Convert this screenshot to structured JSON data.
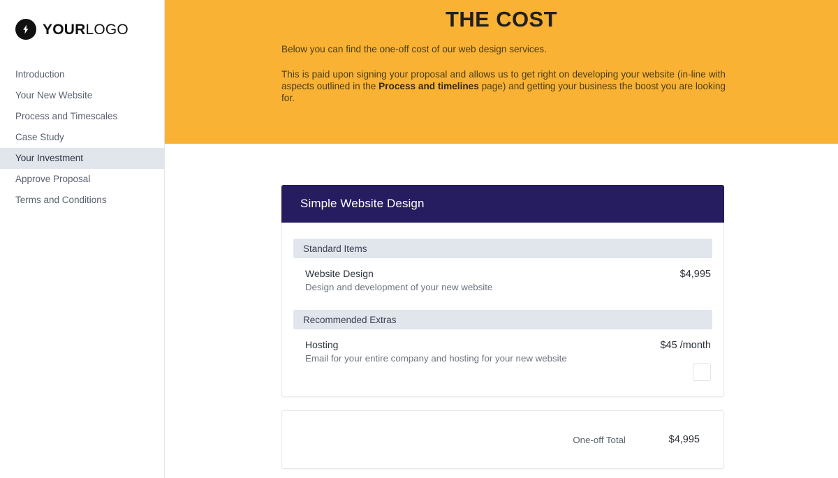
{
  "sidebar": {
    "logo": {
      "icon": "lightning-bolt-icon",
      "text_bold": "YOUR",
      "text_light": "LOGO"
    },
    "items": [
      {
        "label": "Introduction",
        "active": false
      },
      {
        "label": "Your New Website",
        "active": false
      },
      {
        "label": "Process and Timescales",
        "active": false
      },
      {
        "label": "Case Study",
        "active": false
      },
      {
        "label": "Your Investment",
        "active": true
      },
      {
        "label": "Approve Proposal",
        "active": false
      },
      {
        "label": "Terms and Conditions",
        "active": false
      }
    ]
  },
  "hero": {
    "title": "THE COST",
    "paragraph_1": "Below you can find the one-off cost of our web design services.",
    "paragraph_2_part1": "This is paid upon signing your proposal and allows us to get right on developing your website (in-line with aspects outlined in the ",
    "paragraph_2_bold": "Process and timelines",
    "paragraph_2_part2": " page) and getting your business the boost you are looking for.",
    "background_color": "#f9b233"
  },
  "pricing_card": {
    "header_title": "Simple Website Design",
    "header_color": "#261c60",
    "groups": [
      {
        "title": "Standard Items",
        "items": [
          {
            "name": "Website Design",
            "description": "Design and development of your new website",
            "price": "$4,995",
            "has_checkbox": false
          }
        ]
      },
      {
        "title": "Recommended Extras",
        "items": [
          {
            "name": "Hosting",
            "description": "Email for your entire company and hosting for your new website",
            "price": "$45 /month",
            "has_checkbox": true,
            "checkbox_checked": false
          }
        ]
      }
    ]
  },
  "total_card": {
    "label": "One-off Total",
    "value": "$4,995"
  }
}
